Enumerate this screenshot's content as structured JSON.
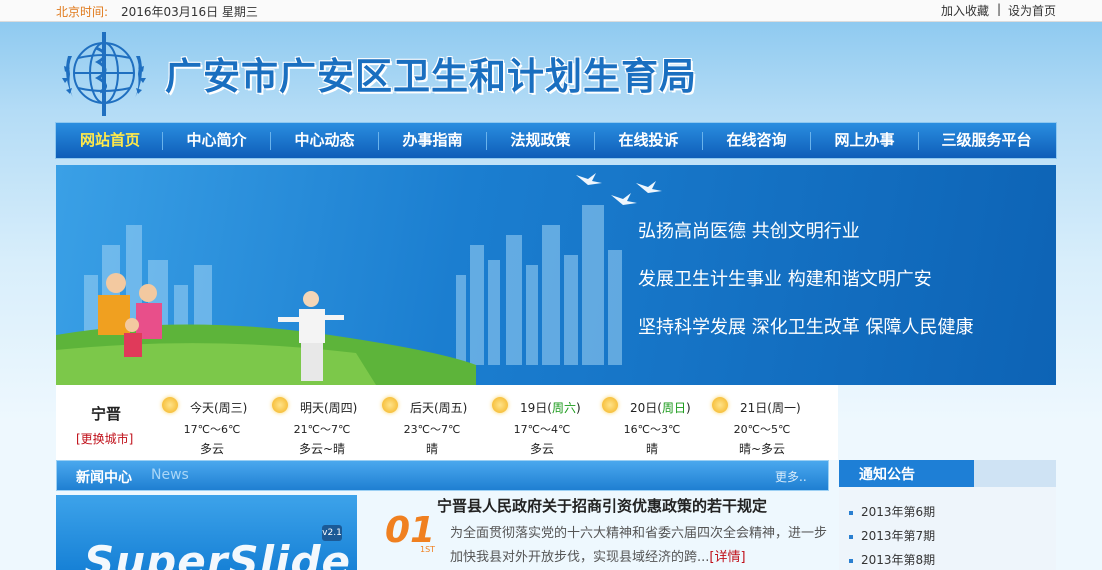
{
  "topbar": {
    "time_label": "北京时间:",
    "time_value": "2016年03月16日  星期三",
    "bookmark": "加入收藏",
    "separator": "|",
    "set_home": "设为首页"
  },
  "header": {
    "title": "广安市广安区卫生和计划生育局"
  },
  "nav": {
    "items": [
      "网站首页",
      "中心简介",
      "中心动态",
      "办事指南",
      "法规政策",
      "在线投诉",
      "在线咨询",
      "网上办事",
      "三级服务平台"
    ]
  },
  "banner": {
    "slogans": [
      "弘扬高尚医德  共创文明行业",
      "发展卫生计生事业  构建和谐文明广安",
      "坚持科学发展  深化卫生改革  保障人民健康"
    ]
  },
  "weather": {
    "city": "宁晋",
    "change_city": "[更换城市]",
    "days": [
      {
        "day": "今天(周三)",
        "weekend": "",
        "temp": "17℃～6℃",
        "cond": "多云"
      },
      {
        "day": "明天(周四)",
        "weekend": "",
        "temp": "21℃～7℃",
        "cond": "多云~晴"
      },
      {
        "day": "后天(周五)",
        "weekend": "",
        "temp": "23℃～7℃",
        "cond": "晴"
      },
      {
        "day": "19日(",
        "weekend": "周六",
        "temp": "17℃～4℃",
        "cond": "多云"
      },
      {
        "day": "20日(",
        "weekend": "周日",
        "temp": "16℃～3℃",
        "cond": "晴"
      },
      {
        "day": "21日(周一)",
        "weekend": "",
        "temp": "20℃～5℃",
        "cond": "晴~多云"
      }
    ],
    "close_paren": ")"
  },
  "news": {
    "title": "新闻中心",
    "title_en": "News",
    "more": "更多..",
    "slide_text": "SuperSlide",
    "slide_badge": "v2.1",
    "rank_num": "01",
    "rank_suffix": "1ST",
    "headline": "宁晋县人民政府关于招商引资优惠政策的若干规定",
    "summary": "为全面贯彻落实党的十六大精神和省委六届四次全会精神，进一步加快我县对外开放步伐，实现县域经济的跨...",
    "detail": "[详情]"
  },
  "notice": {
    "title": "通知公告",
    "items": [
      "2013年第6期",
      "2013年第7期",
      "2013年第8期"
    ]
  },
  "colors": {
    "nav_active": "#ffe94a",
    "accent": "#1a6fc0",
    "link_red": "#c0101a",
    "time_orange": "#e07a1c"
  }
}
